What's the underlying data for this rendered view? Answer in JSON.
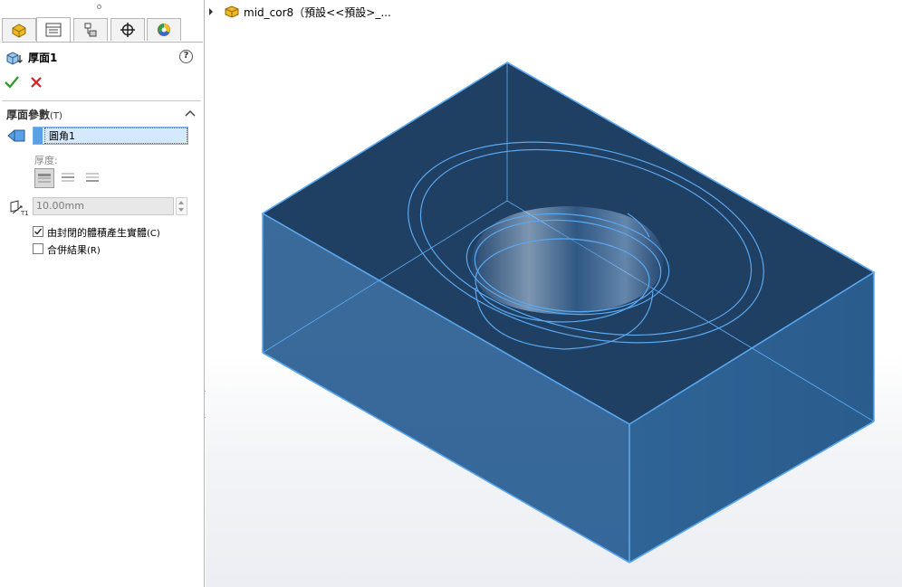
{
  "property_manager": {
    "tabs": [
      {
        "name": "feature-manager-tab",
        "icon": "part-icon"
      },
      {
        "name": "property-manager-tab",
        "icon": "property-list-icon"
      },
      {
        "name": "configuration-manager-tab",
        "icon": "configuration-icon"
      },
      {
        "name": "dimxpert-manager-tab",
        "icon": "crosshair-icon"
      },
      {
        "name": "display-manager-tab",
        "icon": "color-wheel-icon"
      }
    ],
    "feature_title": "厚面1",
    "help_symbol": "?",
    "ok_icon": "checkmark-icon",
    "cancel_icon": "x-icon",
    "group": {
      "title": "厚面參數",
      "hotkey": "(T)",
      "selection_item": "圓角1",
      "thickness_label": "厚度:",
      "depth_value": "10.00mm",
      "options": [
        {
          "label": "由封閉的體積產生實體",
          "hotkey": "(C)",
          "checked": true
        },
        {
          "label": "合併結果",
          "hotkey": "(R)",
          "checked": false
        }
      ]
    }
  },
  "graphics": {
    "breadcrumb": "mid_cor8（預設<<預設>_...",
    "colors": {
      "body_edge": "#5aa8f0",
      "top_face": "#1f3f63",
      "front_face": "#3b6b9a",
      "right_face": "#2f6496",
      "highlight": "#2f8fe8"
    }
  }
}
